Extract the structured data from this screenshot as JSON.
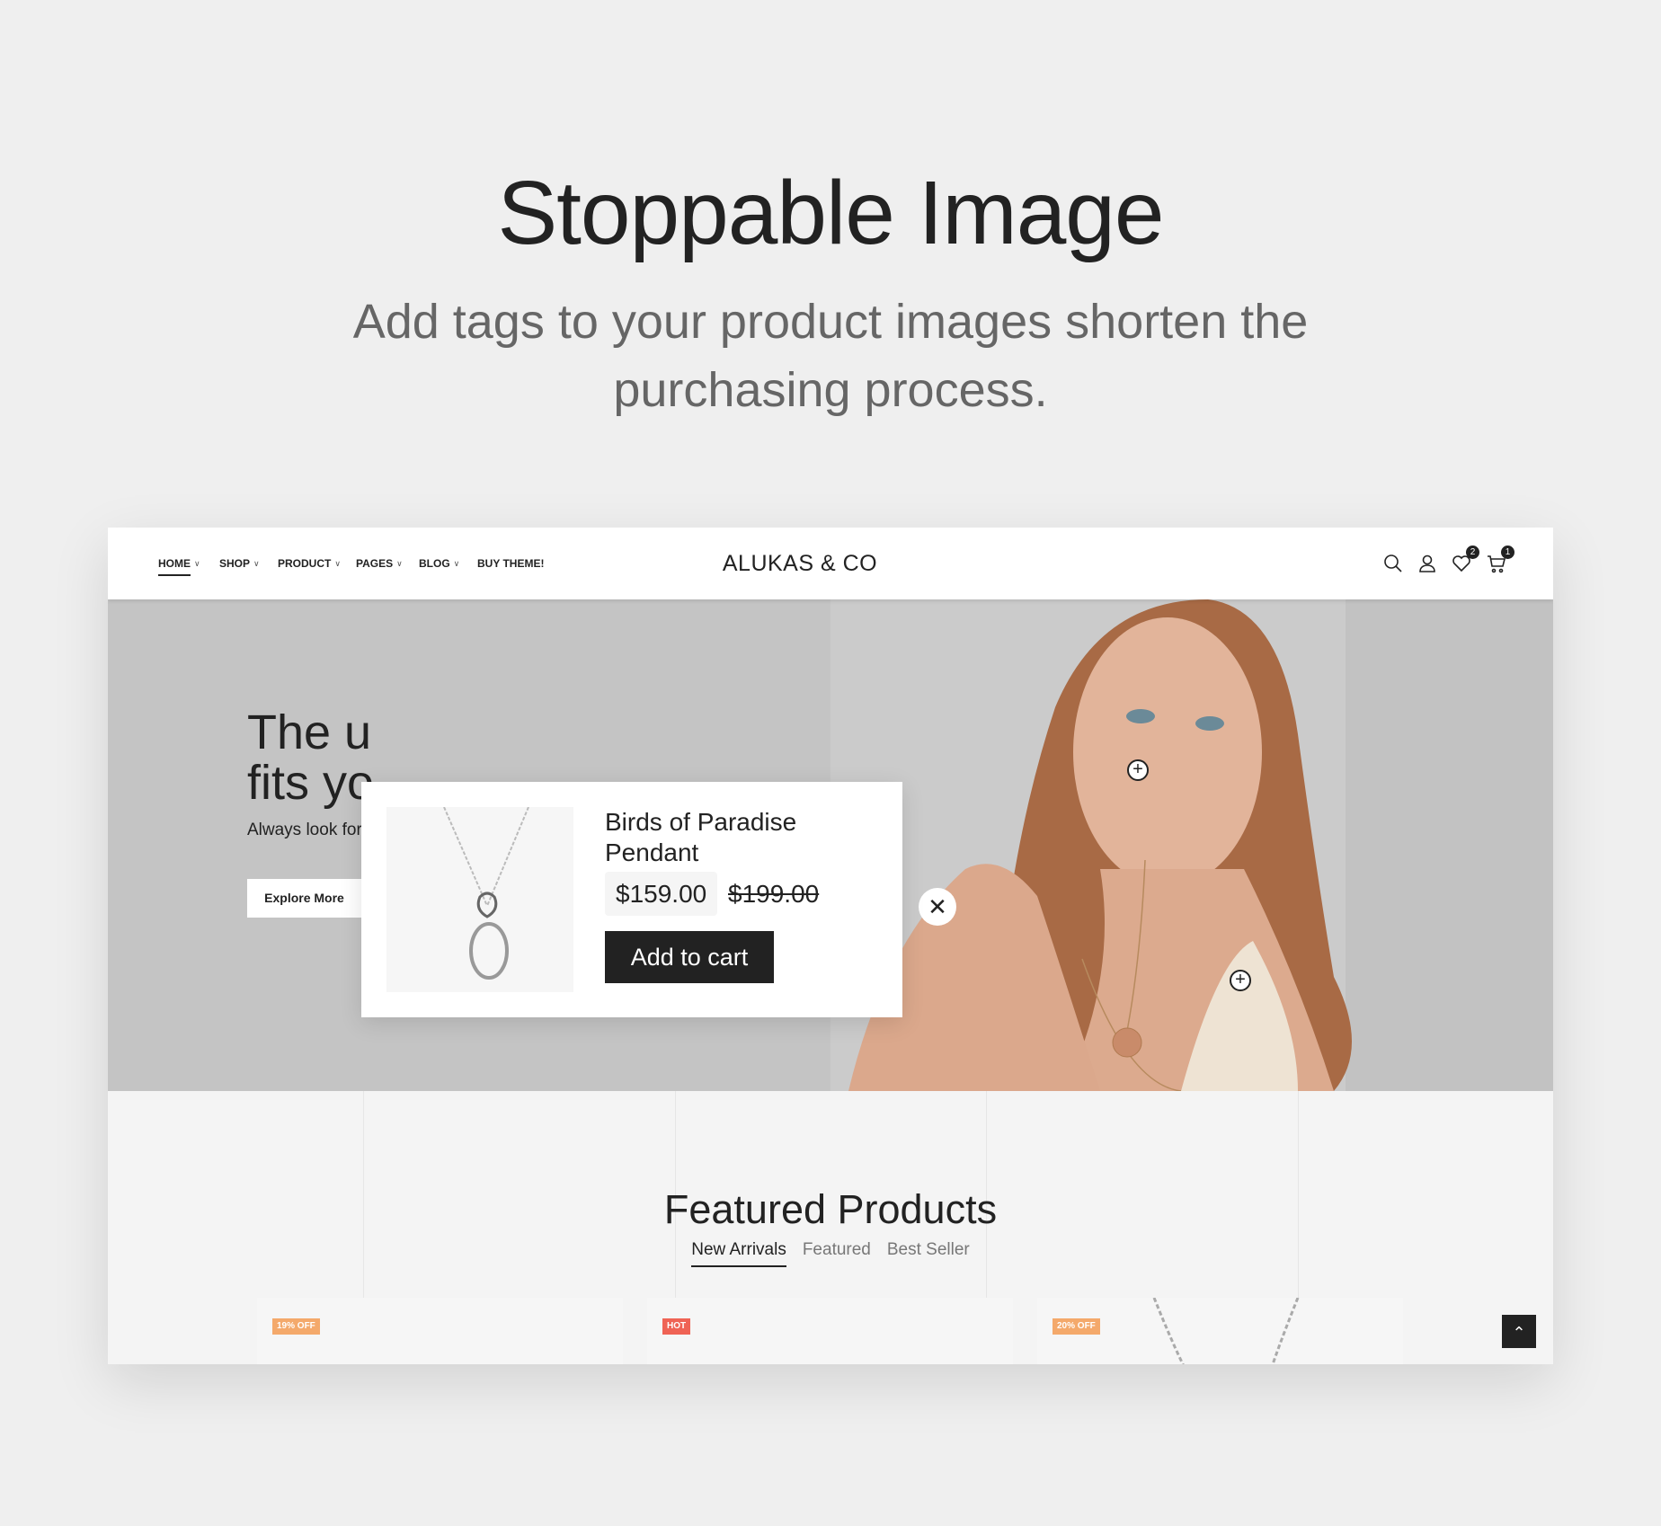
{
  "page": {
    "title": "Stoppable Image",
    "subtitle": "Add tags to your product images shorten the purchasing process."
  },
  "header": {
    "nav": [
      {
        "label": "HOME"
      },
      {
        "label": "SHOP"
      },
      {
        "label": "PRODUCT"
      },
      {
        "label": "PAGES"
      },
      {
        "label": "BLOG"
      },
      {
        "label": "BUY THEME!"
      }
    ],
    "logo": "ALUKAS & CO",
    "wishlist_count": "2",
    "cart_count": "1",
    "icons": [
      "search-icon",
      "user-icon",
      "heart-icon",
      "cart-icon"
    ]
  },
  "hero": {
    "heading_line1": "The u",
    "heading_line2": "fits yo",
    "text": "Always look for",
    "button": "Explore More"
  },
  "popup": {
    "product_name": "Birds of Paradise Pendant",
    "price": "$159.00",
    "old_price": "$199.00",
    "add_to_cart": "Add to cart"
  },
  "featured": {
    "title": "Featured Products",
    "tabs": [
      {
        "label": "New Arrivals",
        "active": true
      },
      {
        "label": "Featured"
      },
      {
        "label": "Best Seller"
      }
    ],
    "cards": [
      {
        "badge": "19% OFF",
        "badge_color": "#f4a96b"
      },
      {
        "badge": "HOT",
        "badge_color": "#ef6355"
      },
      {
        "badge": "20% OFF",
        "badge_color": "#f4a96b"
      }
    ]
  },
  "colors": {
    "accent": "#222222",
    "hero_bg": "#c4c4c4"
  }
}
